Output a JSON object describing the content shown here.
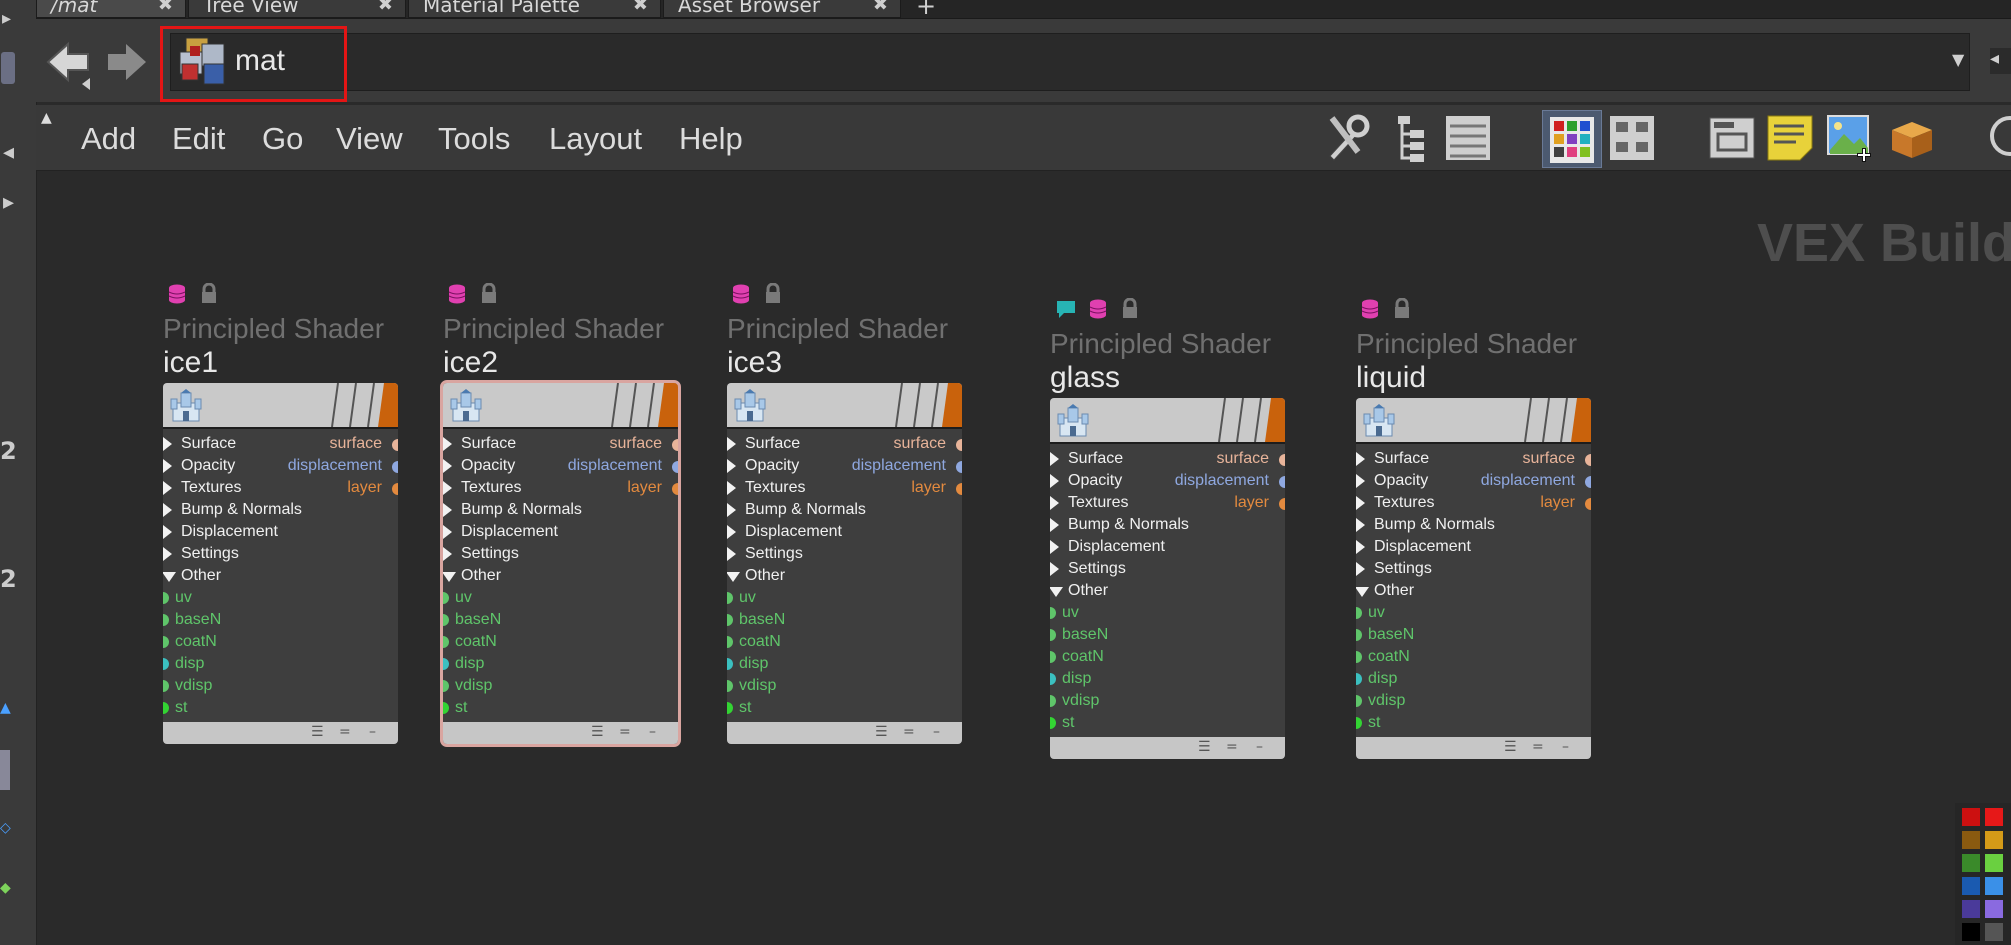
{
  "tabs": [
    {
      "label": "/mat"
    },
    {
      "label": "Tree View"
    },
    {
      "label": "Material Palette"
    },
    {
      "label": "Asset Browser"
    }
  ],
  "tab_add": "+",
  "path": {
    "value": "mat"
  },
  "menu": [
    "Add",
    "Edit",
    "Go",
    "View",
    "Tools",
    "Layout",
    "Help"
  ],
  "network_label": "VEX Builder",
  "nodes": [
    {
      "type": "Principled Shader",
      "name": "ice1"
    },
    {
      "type": "Principled Shader",
      "name": "ice2"
    },
    {
      "type": "Principled Shader",
      "name": "ice3"
    },
    {
      "type": "Principled Shader",
      "name": "glass"
    },
    {
      "type": "Principled Shader",
      "name": "liquid"
    }
  ],
  "sections": [
    "Surface",
    "Opacity",
    "Textures",
    "Bump & Normals",
    "Displacement",
    "Settings",
    "Other"
  ],
  "outputs": [
    "surface",
    "displacement",
    "layer"
  ],
  "inputs": [
    "uv",
    "baseN",
    "coatN",
    "disp",
    "vdisp",
    "st"
  ],
  "colors": {
    "surface_port": "#e8b49a",
    "displacement_port": "#8fa8e0",
    "layer_port": "#e38a3f",
    "input_label": "#5fc56a",
    "disp_input": "#3bc0c0",
    "st_input": "#33d433",
    "selection": "#d9a5a0",
    "highlight": "#e41515",
    "node_orange": "#c9620c"
  },
  "icons": {
    "back": "back-arrow-icon",
    "forward": "forward-arrow-icon",
    "path": "material-network-icon",
    "dropdown": "dropdown-icon",
    "toolbar": [
      "tools-icon",
      "tree-layout-icon",
      "list-icon",
      "color-palette-icon",
      "shape-palette-icon",
      "network-box-icon",
      "sticky-note-icon",
      "add-image-icon",
      "package-icon"
    ],
    "node_flags": [
      "database-icon",
      "lock-icon",
      "comment-icon"
    ],
    "node_thumb": "castle-icon"
  }
}
